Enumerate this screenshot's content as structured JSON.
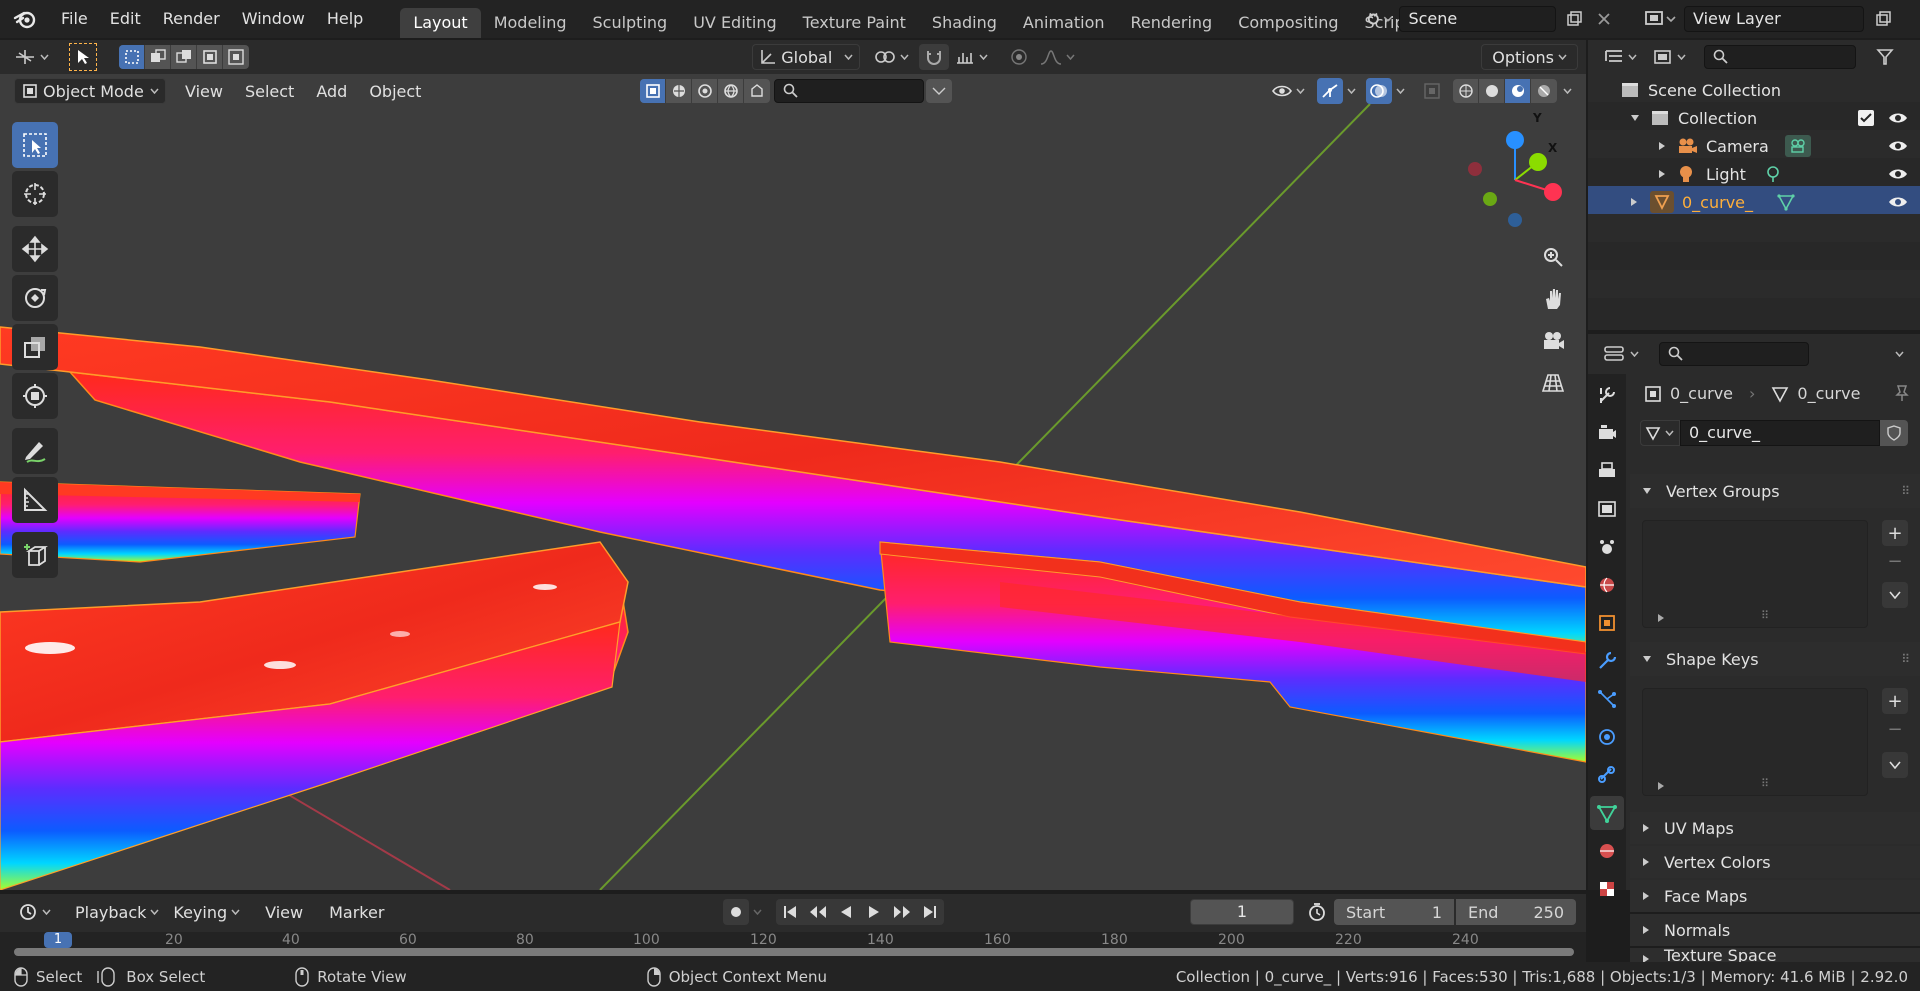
{
  "menubar": {
    "items": [
      "File",
      "Edit",
      "Render",
      "Window",
      "Help"
    ],
    "workspaces": [
      "Layout",
      "Modeling",
      "Sculpting",
      "UV Editing",
      "Texture Paint",
      "Shading",
      "Animation",
      "Rendering",
      "Compositing",
      "Scripting"
    ],
    "active_workspace": "Layout",
    "scene": "Scene",
    "view_layer": "View Layer"
  },
  "tool_header": {
    "orientation": "Global",
    "options": "Options"
  },
  "viewport_header": {
    "mode": "Object Mode",
    "menus": [
      "View",
      "Select",
      "Add",
      "Object"
    ]
  },
  "gizmo": {
    "x": "X",
    "y": "Y",
    "z": "Z"
  },
  "outliner": {
    "scene_collection": "Scene Collection",
    "collection": "Collection",
    "camera": "Camera",
    "light": "Light",
    "curve": "0_curve_"
  },
  "properties": {
    "object_name": "0_curve",
    "data_name": "0_curve",
    "mesh_name": "0_curve_",
    "panels": {
      "vertex_groups": "Vertex Groups",
      "shape_keys": "Shape Keys",
      "uv_maps": "UV Maps",
      "vertex_colors": "Vertex Colors",
      "face_maps": "Face Maps",
      "normals": "Normals",
      "texture_space": "Texture Space"
    }
  },
  "timeline": {
    "menus": [
      "Playback",
      "Keying",
      "View",
      "Marker"
    ],
    "current_frame": "1",
    "start_label": "Start",
    "start": "1",
    "end_label": "End",
    "end": "250",
    "ruler": [
      "1",
      "20",
      "40",
      "60",
      "80",
      "100",
      "120",
      "140",
      "160",
      "180",
      "200",
      "220",
      "240"
    ]
  },
  "statusbar": {
    "select": "Select",
    "box_select": "Box Select",
    "rotate_view": "Rotate View",
    "context_menu": "Object Context Menu",
    "stats": "Collection | 0_curve_ | Verts:916 | Faces:530 | Tris:1,688 | Objects:1/3 | Memory: 41.6 MiB | 2.92.0"
  },
  "colors": {
    "accent": "#4772b3",
    "viewport_bg": "#3d3d3d",
    "axis_x": "#ff3352",
    "axis_y": "#8bdc00",
    "axis_z": "#2890ff"
  }
}
